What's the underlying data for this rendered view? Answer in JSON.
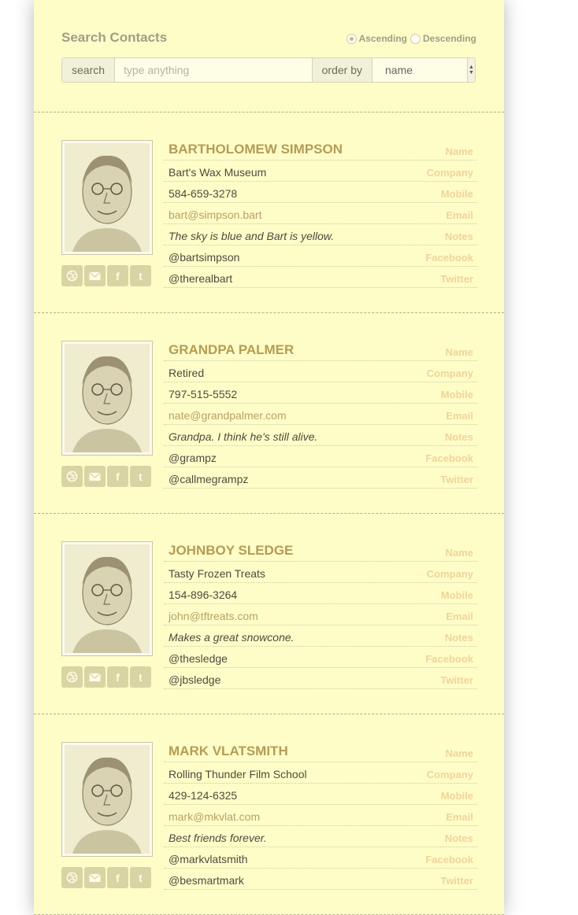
{
  "search": {
    "title": "Search Contacts",
    "sort": {
      "ascending": "Ascending",
      "descending": "Descending",
      "selected": "ascending"
    },
    "search_label": "search",
    "placeholder": "type anything",
    "order_label": "order by",
    "order_value": "name"
  },
  "labels": {
    "name": "Name",
    "company": "Company",
    "mobile": "Mobile",
    "email": "Email",
    "notes": "Notes",
    "facebook": "Facebook",
    "twitter": "Twitter"
  },
  "social_icons": [
    "dribbble-icon",
    "mail-icon",
    "facebook-icon",
    "tumblr-icon"
  ],
  "contacts": [
    {
      "name": "BARTHOLOMEW SIMPSON",
      "company": "Bart's Wax Museum",
      "mobile": "584-659-3278",
      "email": "bart@simpson.bart",
      "notes": "The sky is blue and Bart is yellow.",
      "facebook": "@bartsimpson",
      "twitter": "@therealbart"
    },
    {
      "name": "GRANDPA PALMER",
      "company": "Retired",
      "mobile": "797-515-5552",
      "email": "nate@grandpalmer.com",
      "notes": "Grandpa. I think he's still alive.",
      "facebook": "@grampz",
      "twitter": "@callmegrampz"
    },
    {
      "name": "JOHNBOY SLEDGE",
      "company": "Tasty Frozen Treats",
      "mobile": "154-896-3264",
      "email": "john@tftreats.com",
      "notes": "Makes a great snowcone.",
      "facebook": "@thesledge",
      "twitter": "@jbsledge"
    },
    {
      "name": "MARK VLATSMITH",
      "company": "Rolling Thunder Film School",
      "mobile": "429-124-6325",
      "email": "mark@mkvlat.com",
      "notes": "Best friends forever.",
      "facebook": "@markvlatsmith",
      "twitter": "@besmartmark"
    }
  ]
}
